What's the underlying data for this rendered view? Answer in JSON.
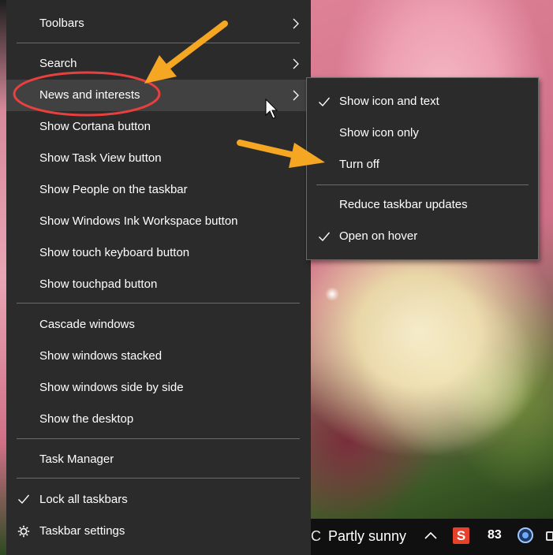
{
  "main_menu": {
    "toolbars": "Toolbars",
    "search": "Search",
    "news": "News and interests",
    "cortana": "Show Cortana button",
    "taskview": "Show Task View button",
    "people": "Show People on the taskbar",
    "ink": "Show Windows Ink Workspace button",
    "touch_keyboard": "Show touch keyboard button",
    "touchpad": "Show touchpad button",
    "cascade": "Cascade windows",
    "stacked": "Show windows stacked",
    "side_by_side": "Show windows side by side",
    "desktop": "Show the desktop",
    "task_manager": "Task Manager",
    "lock": "Lock all taskbars",
    "settings": "Taskbar settings"
  },
  "submenu": {
    "icon_text": "Show icon and text",
    "icon_only": "Show icon only",
    "turn_off": "Turn off",
    "reduce": "Reduce taskbar updates",
    "hover": "Open on hover"
  },
  "taskbar": {
    "weather_glyph": "C",
    "weather": "Partly sunny",
    "app_badge": "S",
    "count": "83"
  },
  "colors": {
    "menu_bg": "#2b2b2b",
    "highlight": "#414141",
    "annotation_circle": "#e8403f",
    "annotation_arrow": "#f5a623"
  }
}
